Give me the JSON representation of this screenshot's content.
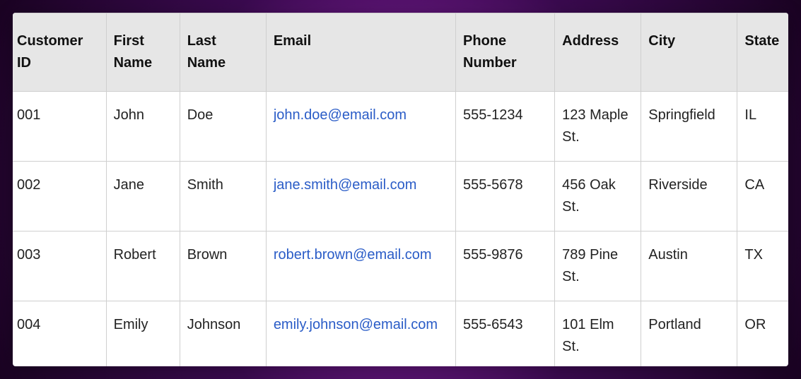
{
  "table": {
    "headers": {
      "customer_id": "Customer ID",
      "first_name": "First Name",
      "last_name": "Last Name",
      "email": "Email",
      "phone": "Phone Number",
      "address": "Address",
      "city": "City",
      "state": "State"
    },
    "rows": [
      {
        "customer_id": "001",
        "first_name": "John",
        "last_name": "Doe",
        "email": "john.doe@email.com",
        "phone": "555-1234",
        "address": "123 Maple St.",
        "city": "Springfield",
        "state": "IL"
      },
      {
        "customer_id": "002",
        "first_name": "Jane",
        "last_name": "Smith",
        "email": "jane.smith@email.com",
        "phone": "555-5678",
        "address": "456 Oak St.",
        "city": "Riverside",
        "state": "CA"
      },
      {
        "customer_id": "003",
        "first_name": "Robert",
        "last_name": "Brown",
        "email": "robert.brown@email.com",
        "phone": "555-9876",
        "address": "789 Pine St.",
        "city": "Austin",
        "state": "TX"
      },
      {
        "customer_id": "004",
        "first_name": "Emily",
        "last_name": "Johnson",
        "email": "emily.johnson@email.com",
        "phone": "555-6543",
        "address": "101 Elm St.",
        "city": "Portland",
        "state": "OR"
      }
    ]
  },
  "colors": {
    "link": "#2a5cc7",
    "header_bg": "#e6e6e6",
    "border": "#cfcfcf"
  }
}
